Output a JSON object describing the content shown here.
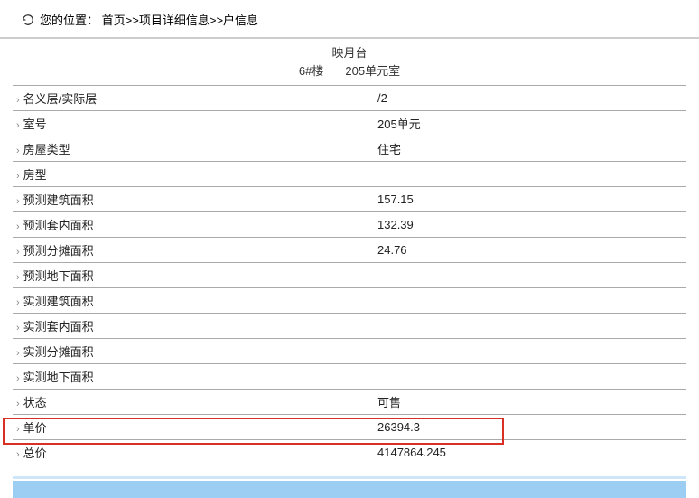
{
  "breadcrumb": {
    "prefix": "您的位置：",
    "item1": "首页",
    "sep1": ">>",
    "item2": "项目详细信息",
    "sep2": ">>",
    "item3": "户信息"
  },
  "header": {
    "title": "映月台",
    "building": "6#楼",
    "unit": "205单元室"
  },
  "rows": [
    {
      "label": "名义层/实际层",
      "value": "/2"
    },
    {
      "label": "室号",
      "value": "205单元"
    },
    {
      "label": "房屋类型",
      "value": "住宅"
    },
    {
      "label": "房型",
      "value": ""
    },
    {
      "label": "预测建筑面积",
      "value": "157.15"
    },
    {
      "label": "预测套内面积",
      "value": "132.39"
    },
    {
      "label": "预测分摊面积",
      "value": "24.76"
    },
    {
      "label": "预测地下面积",
      "value": ""
    },
    {
      "label": "实测建筑面积",
      "value": ""
    },
    {
      "label": "实测套内面积",
      "value": ""
    },
    {
      "label": "实测分摊面积",
      "value": ""
    },
    {
      "label": "实测地下面积",
      "value": ""
    },
    {
      "label": "状态",
      "value": "可售"
    },
    {
      "label": "单价",
      "value": "26394.3"
    },
    {
      "label": "总价",
      "value": "4147864.245"
    }
  ],
  "marker": "›"
}
